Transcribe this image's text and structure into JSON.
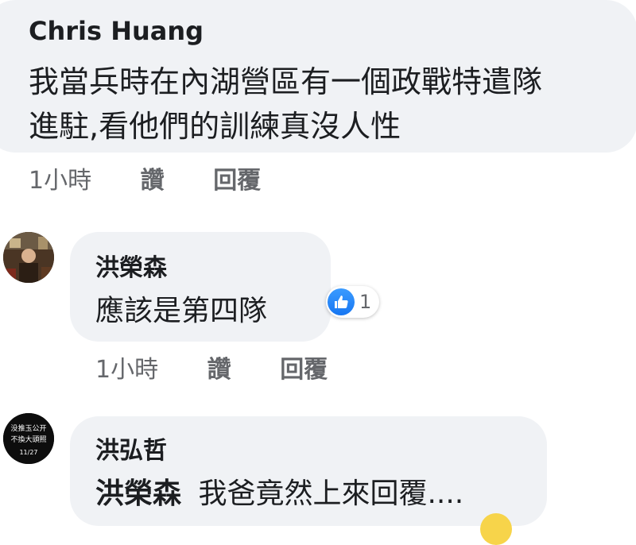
{
  "comments": [
    {
      "author": "Chris Huang",
      "text_line1": "我當兵時在內湖營區有一個政戰特遣隊",
      "text_line2": "進駐,看他們的訓練真沒人性",
      "time": "1小時",
      "like_label": "讚",
      "reply_label": "回覆"
    },
    {
      "author": "洪榮森",
      "text": "應該是第四隊",
      "reaction_count": "1",
      "time": "1小時",
      "like_label": "讚",
      "reply_label": "回覆"
    },
    {
      "author": "洪弘哲",
      "mention": "洪榮森",
      "text": "我爸竟然上來回覆....",
      "avatar_text_line1": "没推玉公开",
      "avatar_text_line2": "不換大頭照",
      "avatar_text_line3": "11/27"
    }
  ]
}
